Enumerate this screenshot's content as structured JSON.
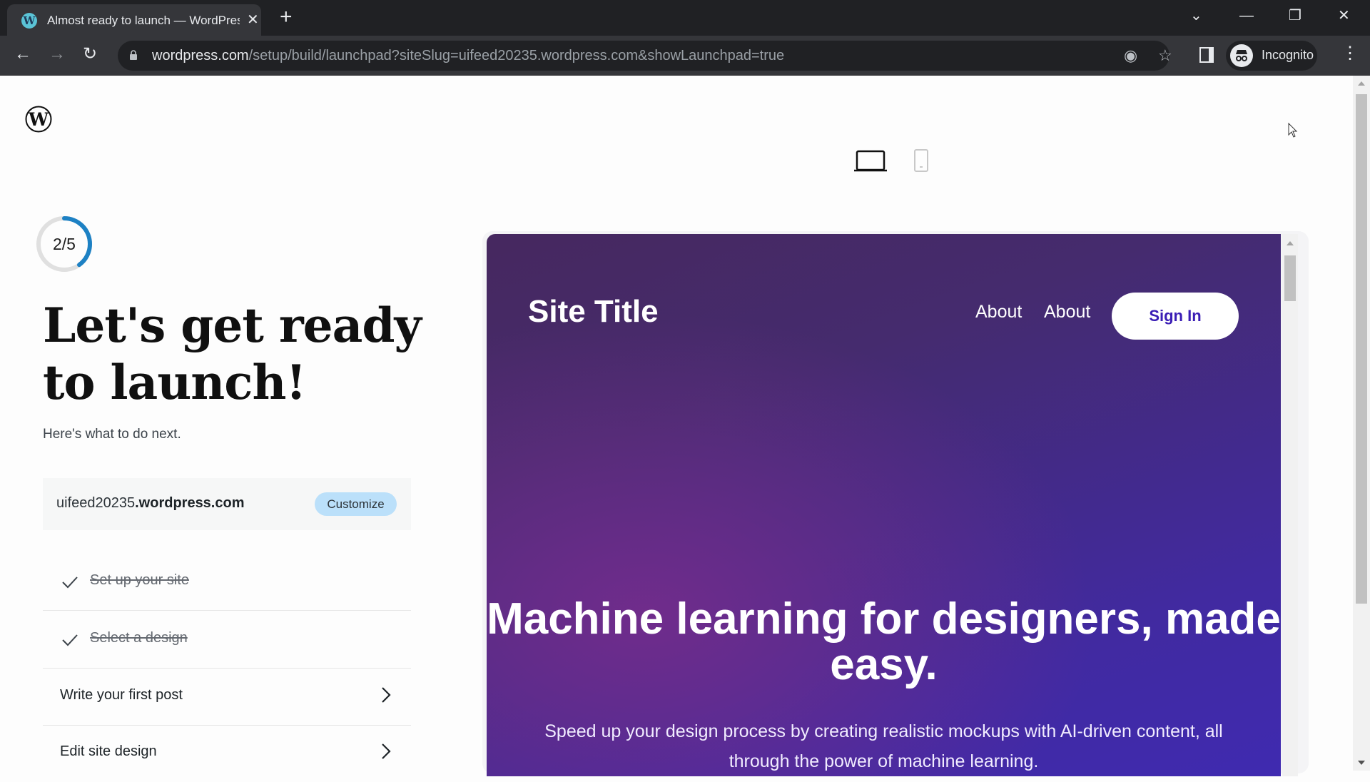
{
  "browser": {
    "tab_title": "Almost ready to launch — WordPress.com",
    "tab_close": "✕",
    "new_tab": "+",
    "url_host": "wordpress.com",
    "url_path": "/setup/build/launchpad?siteSlug=uifeed20235.wordpress.com&showLaunchpad=true",
    "profile_label": "Incognito",
    "icons": {
      "back": "←",
      "forward": "→",
      "reload": "↻",
      "tab_search": "⌄",
      "minimize": "—",
      "restore": "❐",
      "close": "✕",
      "tracking": "◉",
      "bookmark": "☆",
      "menu": "⋮",
      "incognito": "🕶"
    }
  },
  "launchpad": {
    "progress": {
      "completed": 2,
      "total": 5,
      "label": "2/5",
      "accent": "#1d81c4"
    },
    "heading": "Let's get ready to launch!",
    "subtitle": "Here's what to do next.",
    "domain": {
      "prefix": "uifeed20235",
      "suffix": ".wordpress.com"
    },
    "customize_label": "Customize",
    "tasks": [
      {
        "label": "Set up your site",
        "done": true
      },
      {
        "label": "Select a design",
        "done": true
      },
      {
        "label": "Write your first post",
        "done": false
      },
      {
        "label": "Edit site design",
        "done": false
      }
    ]
  },
  "preview": {
    "device_modes": [
      "desktop",
      "mobile"
    ],
    "active_device": "desktop",
    "site_title": "Site Title",
    "nav": [
      "About",
      "About"
    ],
    "signin_label": "Sign In",
    "hero_title": "Machine learning for designers, made easy.",
    "hero_subtitle": "Speed up your design process by creating realistic mockups with AI-driven content, all through the power of machine learning."
  }
}
